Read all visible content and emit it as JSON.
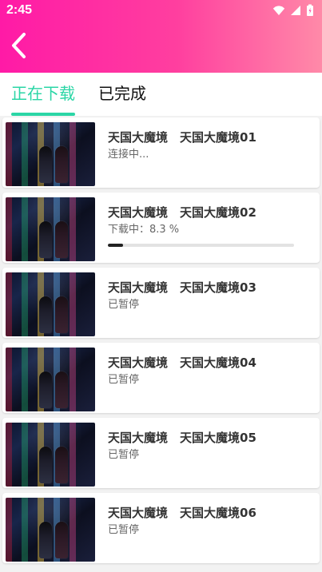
{
  "status_bar": {
    "time": "2:45"
  },
  "header": {
    "back_icon": "chevron-left-icon"
  },
  "tabs": [
    {
      "label": "正在下载",
      "active": true
    },
    {
      "label": "已完成",
      "active": false
    }
  ],
  "downloads": [
    {
      "title": "天国大魔境　天国大魔境01",
      "status": "连接中...",
      "progress": null
    },
    {
      "title": "天国大魔境　天国大魔境02",
      "status": "下载中：8.3 %",
      "progress": 8.3
    },
    {
      "title": "天国大魔境　天国大魔境03",
      "status": "已暂停",
      "progress": null
    },
    {
      "title": "天国大魔境　天国大魔境04",
      "status": "已暂停",
      "progress": null
    },
    {
      "title": "天国大魔境　天国大魔境05",
      "status": "已暂停",
      "progress": null
    },
    {
      "title": "天国大魔境　天国大魔境06",
      "status": "已暂停",
      "progress": null
    }
  ],
  "colors": {
    "header_start": "#ff1aa6",
    "header_end": "#ff8aa8",
    "accent": "#2bd6a6",
    "title_text": "#333333",
    "status_text": "#666666",
    "progress_fill": "#222222",
    "progress_track": "#e3e3e3",
    "page_background": "#f2f2f2"
  }
}
